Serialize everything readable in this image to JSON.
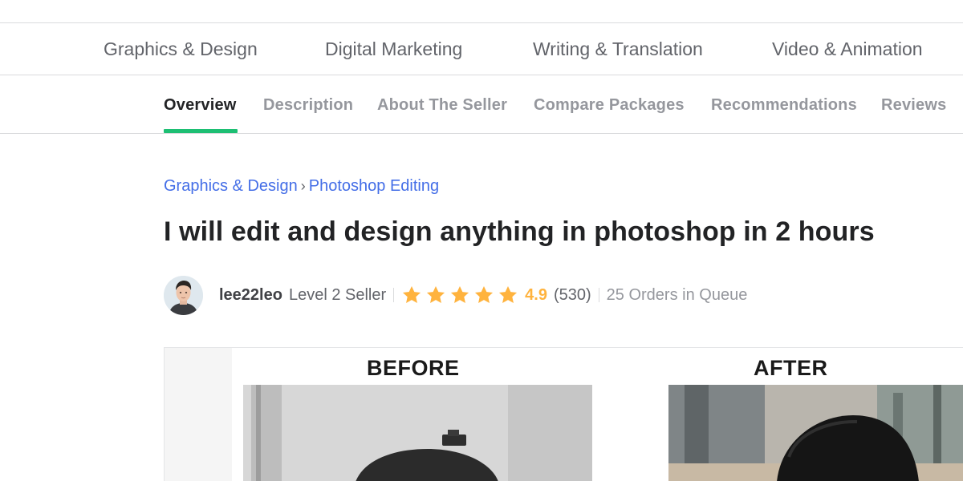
{
  "category_nav": {
    "items": [
      {
        "label": "Graphics & Design"
      },
      {
        "label": "Digital Marketing"
      },
      {
        "label": "Writing & Translation"
      },
      {
        "label": "Video & Animation"
      }
    ]
  },
  "sub_nav": {
    "items": [
      {
        "label": "Overview",
        "active": true
      },
      {
        "label": "Description"
      },
      {
        "label": "About The Seller"
      },
      {
        "label": "Compare Packages"
      },
      {
        "label": "Recommendations"
      },
      {
        "label": "Reviews"
      }
    ],
    "accent_color": "#1dbf73"
  },
  "breadcrumb": {
    "items": [
      "Graphics & Design",
      "Photoshop Editing"
    ],
    "separator": "›"
  },
  "gig": {
    "title": "I will edit and design anything in photoshop in 2 hours"
  },
  "seller": {
    "username": "lee22leo",
    "level": "Level 2 Seller",
    "stars": 5,
    "rating": "4.9",
    "review_count": "(530)",
    "queue": "25 Orders in Queue",
    "star_color": "#ffb33e"
  },
  "gallery": {
    "before_label": "BEFORE",
    "after_label": "AFTER"
  }
}
